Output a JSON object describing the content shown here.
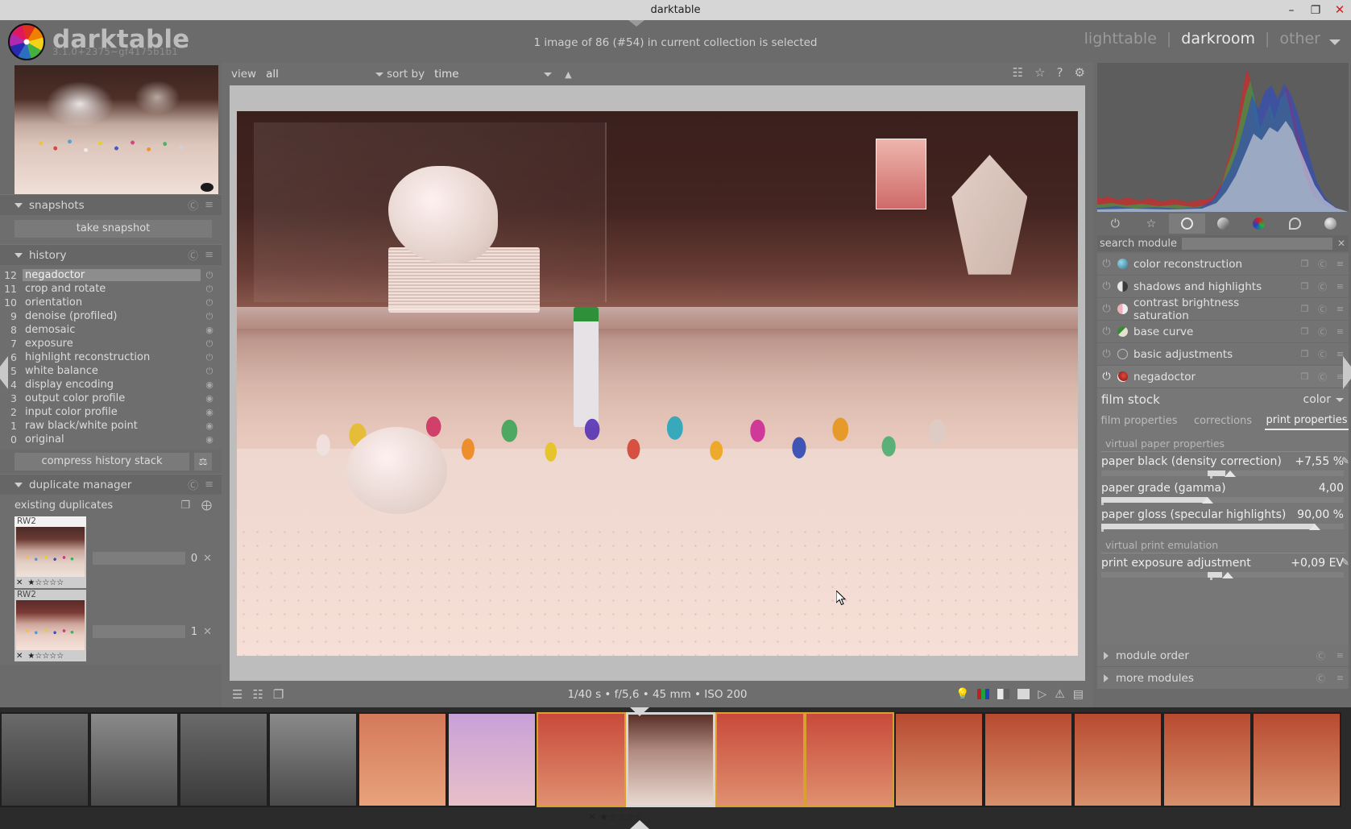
{
  "window": {
    "title": "darktable",
    "minimize": "–",
    "maximize": "❐",
    "close": "✕"
  },
  "header": {
    "app_name": "darktable",
    "version": "3.1.0+2375~gf4175b1b1",
    "collection_status": "1 image of 86 (#54) in current collection is selected",
    "views": [
      {
        "label": "lighttable",
        "active": false
      },
      {
        "label": "|",
        "active": false
      },
      {
        "label": "darkroom",
        "active": true
      },
      {
        "label": "|",
        "active": false
      },
      {
        "label": "other",
        "active": false
      }
    ]
  },
  "filter_bar": {
    "view_label": "view",
    "view_value": "all",
    "sort_label": "sort by",
    "sort_value": "time",
    "sort_direction": "▲",
    "icons": [
      "grid-icon",
      "star-icon",
      "help-icon",
      "gear-icon"
    ]
  },
  "left_panel": {
    "snapshots": {
      "title": "snapshots",
      "collapsed": false,
      "take_snapshot": "take snapshot"
    },
    "history": {
      "title": "history",
      "collapsed": false,
      "items": [
        {
          "num": "12",
          "label": "negadoctor",
          "selected": true,
          "icon": "power-icon"
        },
        {
          "num": "11",
          "label": "crop and rotate",
          "selected": false,
          "icon": "power-icon"
        },
        {
          "num": "10",
          "label": "orientation",
          "selected": false,
          "icon": "power-icon"
        },
        {
          "num": "9",
          "label": "denoise (profiled)",
          "selected": false,
          "icon": "power-icon"
        },
        {
          "num": "8",
          "label": "demosaic",
          "selected": false,
          "icon": "circle-icon"
        },
        {
          "num": "7",
          "label": "exposure",
          "selected": false,
          "icon": "power-icon"
        },
        {
          "num": "6",
          "label": "highlight reconstruction",
          "selected": false,
          "icon": "power-icon"
        },
        {
          "num": "5",
          "label": "white balance",
          "selected": false,
          "icon": "power-icon"
        },
        {
          "num": "4",
          "label": "display encoding",
          "selected": false,
          "icon": "circle-icon"
        },
        {
          "num": "3",
          "label": "output color profile",
          "selected": false,
          "icon": "circle-icon"
        },
        {
          "num": "2",
          "label": "input color profile",
          "selected": false,
          "icon": "circle-icon"
        },
        {
          "num": "1",
          "label": "raw black/white point",
          "selected": false,
          "icon": "circle-icon"
        },
        {
          "num": "0",
          "label": "original",
          "selected": false,
          "icon": "circle-icon"
        }
      ],
      "compress_label": "compress history stack"
    },
    "duplicate_manager": {
      "title": "duplicate manager",
      "collapsed": false,
      "existing_label": "existing duplicates",
      "duplicates": [
        {
          "ext": "RW2",
          "number": "0",
          "stars": "★☆☆☆☆",
          "selected": true
        },
        {
          "ext": "RW2",
          "number": "1",
          "stars": "★☆☆☆☆",
          "selected": false
        }
      ]
    }
  },
  "right_panel": {
    "module_group_tabs": [
      {
        "icon": "power-icon",
        "active": false
      },
      {
        "icon": "favorites-star-icon",
        "active": false
      },
      {
        "icon": "technical-circle-icon",
        "active": true
      },
      {
        "icon": "tone-gradient-icon",
        "active": false
      },
      {
        "icon": "color-wheel-icon",
        "active": false
      },
      {
        "icon": "correction-icon",
        "active": false
      },
      {
        "icon": "effects-icon",
        "active": false
      }
    ],
    "search": {
      "label": "search module",
      "value": "",
      "placeholder": "",
      "clear_icon": "clear-icon"
    },
    "modules": [
      {
        "name": "color reconstruction",
        "enabled": false,
        "icon": "color-reconstruction-icon"
      },
      {
        "name": "shadows and highlights",
        "enabled": false,
        "icon": "shadows-highlights-icon"
      },
      {
        "name": "contrast brightness saturation",
        "enabled": false,
        "icon": "contrast-brightness-saturation-icon"
      },
      {
        "name": "base curve",
        "enabled": false,
        "icon": "base-curve-icon"
      },
      {
        "name": "basic adjustments",
        "enabled": false,
        "icon": "basic-adjustments-icon"
      },
      {
        "name": "negadoctor",
        "enabled": true,
        "icon": "negadoctor-icon"
      }
    ],
    "negadoctor": {
      "film_stock_label": "film stock",
      "film_stock_value": "color",
      "tabs": [
        {
          "label": "film properties",
          "active": false
        },
        {
          "label": "corrections",
          "active": false
        },
        {
          "label": "print properties",
          "active": true
        }
      ],
      "section_paper": "virtual paper properties",
      "sliders_paper": [
        {
          "label": "paper black (density correction)",
          "value": "+7,55 %",
          "fill_pct": 48,
          "thumb_pct": 53
        },
        {
          "label": "paper grade (gamma)",
          "value": "4,00",
          "fill_pct": 44,
          "thumb_pct": 44
        },
        {
          "label": "paper gloss (specular highlights)",
          "value": "90,00 %",
          "fill_pct": 88,
          "thumb_pct": 88
        }
      ],
      "section_print": "virtual print emulation",
      "sliders_print": [
        {
          "label": "print exposure adjustment",
          "value": "+0,09 EV",
          "fill_pct": 48,
          "thumb_pct": 52
        }
      ],
      "picker_icon": "color-picker-icon"
    },
    "collapsed_modules": [
      {
        "label": "module order"
      },
      {
        "label": "more modules"
      }
    ]
  },
  "status_bar": {
    "exif": "1/40 s • f/5,6 • 45 mm • ISO 200",
    "left_icons": [
      "list-view-icon",
      "grid-view-icon",
      "duplicate-view-icon"
    ],
    "right_icons": [
      "focus-peaking-icon",
      "rgb-display-icon",
      "grayscale-icon",
      "gamut-check-icon",
      "play-icon",
      "warning-icon",
      "raw-overexposed-icon"
    ]
  },
  "filmstrip": {
    "rating_x": "✕",
    "rating_stars": "★☆☆☆☆",
    "thumbs": [
      {
        "style": "film-neg-a",
        "state": "none"
      },
      {
        "style": "film-neg-b",
        "state": "none"
      },
      {
        "style": "film-neg-a",
        "state": "none"
      },
      {
        "style": "film-neg-b",
        "state": "none"
      },
      {
        "style": "film-or",
        "state": "none"
      },
      {
        "style": "film-pk",
        "state": "none"
      },
      {
        "style": "film-red",
        "state": "selected"
      },
      {
        "style": "film-lt",
        "state": "active"
      },
      {
        "style": "film-red",
        "state": "selected"
      },
      {
        "style": "film-red",
        "state": "selected"
      },
      {
        "style": "film-or2",
        "state": "none"
      },
      {
        "style": "film-or2",
        "state": "none"
      },
      {
        "style": "film-or2",
        "state": "none"
      },
      {
        "style": "film-or2",
        "state": "none"
      },
      {
        "style": "film-or2",
        "state": "none"
      }
    ]
  },
  "colors": {
    "panel_bg": "#6b6b6b",
    "module_bg": "#737373",
    "accent_selected": "#d8a030",
    "text": "#dcdcdc"
  }
}
